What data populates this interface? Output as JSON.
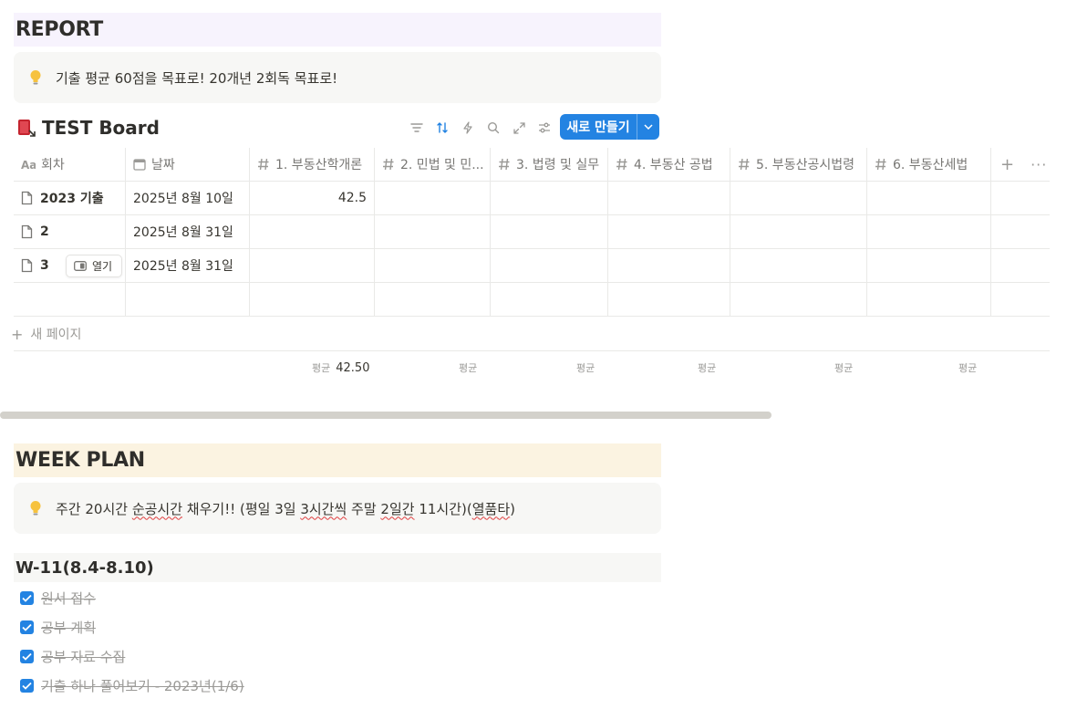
{
  "report": {
    "heading": "REPORT",
    "callout_text": "기출 평균 60점을 목표로! 20개년 2회독 목표로!"
  },
  "board": {
    "title": "TEST Board",
    "new_button_label": "새로 만들기",
    "columns": [
      "회차",
      "날짜",
      "1. 부동산학개론",
      "2. 민법 및 민...",
      "3. 법령 및 실무",
      "4. 부동산 공법",
      "5. 부동산공시법령",
      "6. 부동산세법"
    ],
    "rows": [
      {
        "name": "2023 기출",
        "date": "2025년 8월 10일",
        "score1": "42.5"
      },
      {
        "name": "2",
        "date": "2025년 8월 31일",
        "score1": ""
      },
      {
        "name": "3",
        "date": "2025년 8월 31일",
        "score1": ""
      }
    ],
    "open_button_label": "열기",
    "new_page_label": "새 페이지",
    "aggregate_label": "평균",
    "aggregate_value_1": "42.50"
  },
  "week": {
    "heading": "WEEK PLAN",
    "callout_parts": [
      "주간 20시간 ",
      "순공시간",
      " 채우기!! (평일 3일 ",
      "3시간씩",
      " 주말 ",
      "2일간",
      " 11시간)(",
      "열품타",
      ")"
    ],
    "sub_heading": "W-11(8.4-8.10)",
    "todos": [
      "원서 접수",
      "공부 계획",
      "공부 자료 수집",
      "기출 하나 풀어보기 - 2023년(1/6)"
    ]
  }
}
